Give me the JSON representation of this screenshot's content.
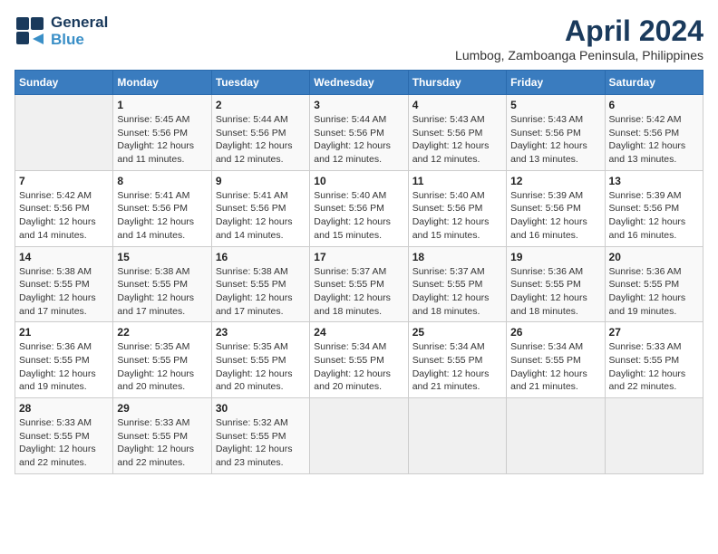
{
  "header": {
    "logo_line1": "General",
    "logo_line2": "Blue",
    "month_title": "April 2024",
    "location": "Lumbog, Zamboanga Peninsula, Philippines"
  },
  "calendar": {
    "days_of_week": [
      "Sunday",
      "Monday",
      "Tuesday",
      "Wednesday",
      "Thursday",
      "Friday",
      "Saturday"
    ],
    "weeks": [
      [
        {
          "day": "",
          "info": ""
        },
        {
          "day": "1",
          "info": "Sunrise: 5:45 AM\nSunset: 5:56 PM\nDaylight: 12 hours\nand 11 minutes."
        },
        {
          "day": "2",
          "info": "Sunrise: 5:44 AM\nSunset: 5:56 PM\nDaylight: 12 hours\nand 12 minutes."
        },
        {
          "day": "3",
          "info": "Sunrise: 5:44 AM\nSunset: 5:56 PM\nDaylight: 12 hours\nand 12 minutes."
        },
        {
          "day": "4",
          "info": "Sunrise: 5:43 AM\nSunset: 5:56 PM\nDaylight: 12 hours\nand 12 minutes."
        },
        {
          "day": "5",
          "info": "Sunrise: 5:43 AM\nSunset: 5:56 PM\nDaylight: 12 hours\nand 13 minutes."
        },
        {
          "day": "6",
          "info": "Sunrise: 5:42 AM\nSunset: 5:56 PM\nDaylight: 12 hours\nand 13 minutes."
        }
      ],
      [
        {
          "day": "7",
          "info": "Sunrise: 5:42 AM\nSunset: 5:56 PM\nDaylight: 12 hours\nand 14 minutes."
        },
        {
          "day": "8",
          "info": "Sunrise: 5:41 AM\nSunset: 5:56 PM\nDaylight: 12 hours\nand 14 minutes."
        },
        {
          "day": "9",
          "info": "Sunrise: 5:41 AM\nSunset: 5:56 PM\nDaylight: 12 hours\nand 14 minutes."
        },
        {
          "day": "10",
          "info": "Sunrise: 5:40 AM\nSunset: 5:56 PM\nDaylight: 12 hours\nand 15 minutes."
        },
        {
          "day": "11",
          "info": "Sunrise: 5:40 AM\nSunset: 5:56 PM\nDaylight: 12 hours\nand 15 minutes."
        },
        {
          "day": "12",
          "info": "Sunrise: 5:39 AM\nSunset: 5:56 PM\nDaylight: 12 hours\nand 16 minutes."
        },
        {
          "day": "13",
          "info": "Sunrise: 5:39 AM\nSunset: 5:56 PM\nDaylight: 12 hours\nand 16 minutes."
        }
      ],
      [
        {
          "day": "14",
          "info": "Sunrise: 5:38 AM\nSunset: 5:55 PM\nDaylight: 12 hours\nand 17 minutes."
        },
        {
          "day": "15",
          "info": "Sunrise: 5:38 AM\nSunset: 5:55 PM\nDaylight: 12 hours\nand 17 minutes."
        },
        {
          "day": "16",
          "info": "Sunrise: 5:38 AM\nSunset: 5:55 PM\nDaylight: 12 hours\nand 17 minutes."
        },
        {
          "day": "17",
          "info": "Sunrise: 5:37 AM\nSunset: 5:55 PM\nDaylight: 12 hours\nand 18 minutes."
        },
        {
          "day": "18",
          "info": "Sunrise: 5:37 AM\nSunset: 5:55 PM\nDaylight: 12 hours\nand 18 minutes."
        },
        {
          "day": "19",
          "info": "Sunrise: 5:36 AM\nSunset: 5:55 PM\nDaylight: 12 hours\nand 18 minutes."
        },
        {
          "day": "20",
          "info": "Sunrise: 5:36 AM\nSunset: 5:55 PM\nDaylight: 12 hours\nand 19 minutes."
        }
      ],
      [
        {
          "day": "21",
          "info": "Sunrise: 5:36 AM\nSunset: 5:55 PM\nDaylight: 12 hours\nand 19 minutes."
        },
        {
          "day": "22",
          "info": "Sunrise: 5:35 AM\nSunset: 5:55 PM\nDaylight: 12 hours\nand 20 minutes."
        },
        {
          "day": "23",
          "info": "Sunrise: 5:35 AM\nSunset: 5:55 PM\nDaylight: 12 hours\nand 20 minutes."
        },
        {
          "day": "24",
          "info": "Sunrise: 5:34 AM\nSunset: 5:55 PM\nDaylight: 12 hours\nand 20 minutes."
        },
        {
          "day": "25",
          "info": "Sunrise: 5:34 AM\nSunset: 5:55 PM\nDaylight: 12 hours\nand 21 minutes."
        },
        {
          "day": "26",
          "info": "Sunrise: 5:34 AM\nSunset: 5:55 PM\nDaylight: 12 hours\nand 21 minutes."
        },
        {
          "day": "27",
          "info": "Sunrise: 5:33 AM\nSunset: 5:55 PM\nDaylight: 12 hours\nand 22 minutes."
        }
      ],
      [
        {
          "day": "28",
          "info": "Sunrise: 5:33 AM\nSunset: 5:55 PM\nDaylight: 12 hours\nand 22 minutes."
        },
        {
          "day": "29",
          "info": "Sunrise: 5:33 AM\nSunset: 5:55 PM\nDaylight: 12 hours\nand 22 minutes."
        },
        {
          "day": "30",
          "info": "Sunrise: 5:32 AM\nSunset: 5:55 PM\nDaylight: 12 hours\nand 23 minutes."
        },
        {
          "day": "",
          "info": ""
        },
        {
          "day": "",
          "info": ""
        },
        {
          "day": "",
          "info": ""
        },
        {
          "day": "",
          "info": ""
        }
      ]
    ]
  }
}
